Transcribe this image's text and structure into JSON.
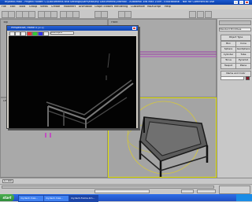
{
  "app": {
    "title": "mydeck.max - Project Folder: C:\\Documents and Settings\\Sam\\Max\\My Documents\\3dsmax - Autodesk 3ds Max 2009 - Educational - Not for Commercial Use",
    "menus": [
      "File",
      "Edit",
      "Tools",
      "Group",
      "Views",
      "Create",
      "Modifiers",
      "Animation",
      "Graph Editors",
      "Rendering",
      "Customize",
      "MAXScript",
      "Help"
    ]
  },
  "float_window": {
    "title": "Perspective, frame 0 (1:1)",
    "channel_value": "RGB Alpha"
  },
  "viewports": {
    "top_left": "Top",
    "top_right": "Front",
    "bottom_left": "Left",
    "bottom_right": "Perspective"
  },
  "command_panel": {
    "title": "Standard Primitives",
    "buttons": [
      "Object Type",
      "Box",
      "Cone",
      "Sphere",
      "GeoSphere",
      "Cylinder",
      "Tube",
      "Torus",
      "Pyramid",
      "Teapot",
      "Plane",
      "Name and Color"
    ]
  },
  "timeline": {
    "frame_label": "0 / 100"
  },
  "taskbar": {
    "start_label": "start",
    "items": [
      "mydeck.max...",
      "mydeck.max...",
      "mydeck-frame.bm..."
    ]
  },
  "colors": {
    "title_blue": "#0a3fa8",
    "selection_yellow": "#e2e200",
    "render_bg": "#030303"
  }
}
